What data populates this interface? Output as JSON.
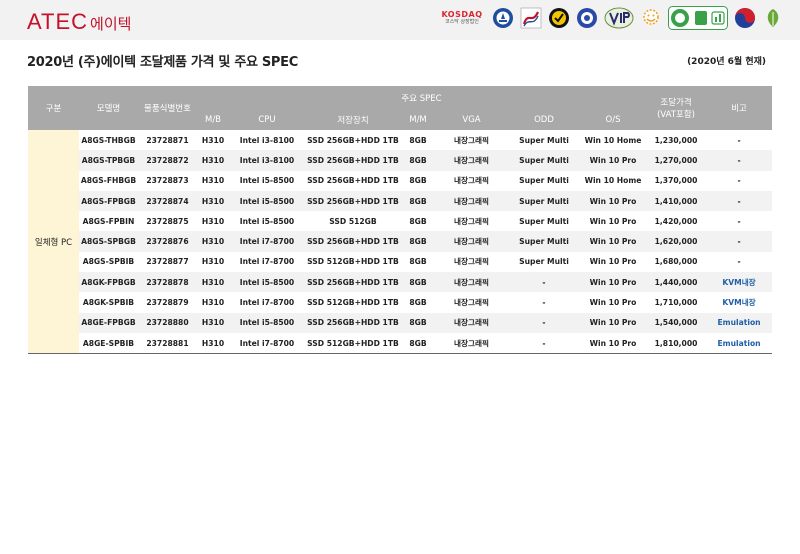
{
  "header": {
    "logo_main": "ATEC",
    "logo_sub": "에이텍",
    "partner_logos": [
      {
        "icon": "kosdaq-logo",
        "line1": "KOSDAQ",
        "line2": "코스닥 상장법인"
      },
      {
        "icon": "certification-seal-blue-icon"
      },
      {
        "icon": "certification-red-wave-icon"
      },
      {
        "icon": "certification-yellow-emblem-icon"
      },
      {
        "icon": "certification-blue-emblem-icon"
      },
      {
        "icon": "vip-badge-icon"
      },
      {
        "icon": "sun-smile-icon"
      },
      {
        "icon": "green-energy-badge-icon"
      },
      {
        "icon": "korea-taegeuk-icon"
      },
      {
        "icon": "green-leaf-badge-icon"
      }
    ]
  },
  "page": {
    "title": "2020년 (주)에이텍 조달제품 가격 및 주요 SPEC",
    "as_of": "(2020년 6월 현재)"
  },
  "table": {
    "headers": {
      "category": "구분",
      "model": "모델명",
      "item_id": "물품식별번호",
      "spec_group": "주요 SPEC",
      "mb": "M/B",
      "cpu": "CPU",
      "storage": "저장장치",
      "mm": "M/M",
      "vga": "VGA",
      "odd": "ODD",
      "os": "O/S",
      "price_line1": "조달가격",
      "price_line2": "(VAT포함)",
      "note": "비고"
    },
    "category_label": "일체형 PC",
    "rows": [
      {
        "model": "A8GS-THBGB",
        "id": "23728871",
        "mb": "H310",
        "cpu": "Intel i3-8100",
        "storage": "SSD 256GB+HDD 1TB",
        "mm": "8GB",
        "vga": "내장그래픽",
        "odd": "Super Multi",
        "os": "Win 10 Home",
        "price": "1,230,000",
        "note": "-"
      },
      {
        "model": "A8GS-TPBGB",
        "id": "23728872",
        "mb": "H310",
        "cpu": "Intel i3-8100",
        "storage": "SSD 256GB+HDD 1TB",
        "mm": "8GB",
        "vga": "내장그래픽",
        "odd": "Super Multi",
        "os": "Win 10 Pro",
        "price": "1,270,000",
        "note": "-"
      },
      {
        "model": "A8GS-FHBGB",
        "id": "23728873",
        "mb": "H310",
        "cpu": "Intel i5-8500",
        "storage": "SSD 256GB+HDD 1TB",
        "mm": "8GB",
        "vga": "내장그래픽",
        "odd": "Super Multi",
        "os": "Win 10 Home",
        "price": "1,370,000",
        "note": "-"
      },
      {
        "model": "A8GS-FPBGB",
        "id": "23728874",
        "mb": "H310",
        "cpu": "Intel i5-8500",
        "storage": "SSD 256GB+HDD 1TB",
        "mm": "8GB",
        "vga": "내장그래픽",
        "odd": "Super Multi",
        "os": "Win 10 Pro",
        "price": "1,410,000",
        "note": "-"
      },
      {
        "model": "A8GS-FPBIN",
        "id": "23728875",
        "mb": "H310",
        "cpu": "Intel i5-8500",
        "storage": "SSD 512GB",
        "mm": "8GB",
        "vga": "내장그래픽",
        "odd": "Super Multi",
        "os": "Win 10 Pro",
        "price": "1,420,000",
        "note": "-"
      },
      {
        "model": "A8GS-SPBGB",
        "id": "23728876",
        "mb": "H310",
        "cpu": "Intel i7-8700",
        "storage": "SSD 256GB+HDD 1TB",
        "mm": "8GB",
        "vga": "내장그래픽",
        "odd": "Super Multi",
        "os": "Win 10 Pro",
        "price": "1,620,000",
        "note": "-"
      },
      {
        "model": "A8GS-SPBIB",
        "id": "23728877",
        "mb": "H310",
        "cpu": "Intel i7-8700",
        "storage": "SSD 512GB+HDD 1TB",
        "mm": "8GB",
        "vga": "내장그래픽",
        "odd": "Super Multi",
        "os": "Win 10 Pro",
        "price": "1,680,000",
        "note": "-"
      },
      {
        "model": "A8GK-FPBGB",
        "id": "23728878",
        "mb": "H310",
        "cpu": "Intel i5-8500",
        "storage": "SSD 256GB+HDD 1TB",
        "mm": "8GB",
        "vga": "내장그래픽",
        "odd": "-",
        "os": "Win 10 Pro",
        "price": "1,440,000",
        "note": "KVM내장"
      },
      {
        "model": "A8GK-SPBIB",
        "id": "23728879",
        "mb": "H310",
        "cpu": "Intel i7-8700",
        "storage": "SSD 512GB+HDD 1TB",
        "mm": "8GB",
        "vga": "내장그래픽",
        "odd": "-",
        "os": "Win 10 Pro",
        "price": "1,710,000",
        "note": "KVM내장"
      },
      {
        "model": "A8GE-FPBGB",
        "id": "23728880",
        "mb": "H310",
        "cpu": "Intel i5-8500",
        "storage": "SSD 256GB+HDD 1TB",
        "mm": "8GB",
        "vga": "내장그래픽",
        "odd": "-",
        "os": "Win 10 Pro",
        "price": "1,540,000",
        "note": "Emulation"
      },
      {
        "model": "A8GE-SPBIB",
        "id": "23728881",
        "mb": "H310",
        "cpu": "Intel i7-8700",
        "storage": "SSD 512GB+HDD 1TB",
        "mm": "8GB",
        "vga": "내장그래픽",
        "odd": "-",
        "os": "Win 10 Pro",
        "price": "1,810,000",
        "note": "Emulation"
      }
    ]
  },
  "colors": {
    "brand_red": "#c3122a",
    "header_gray": "#a9a9a9",
    "category_bg": "#fdf5d6",
    "note_blue": "#1f5fa8"
  }
}
